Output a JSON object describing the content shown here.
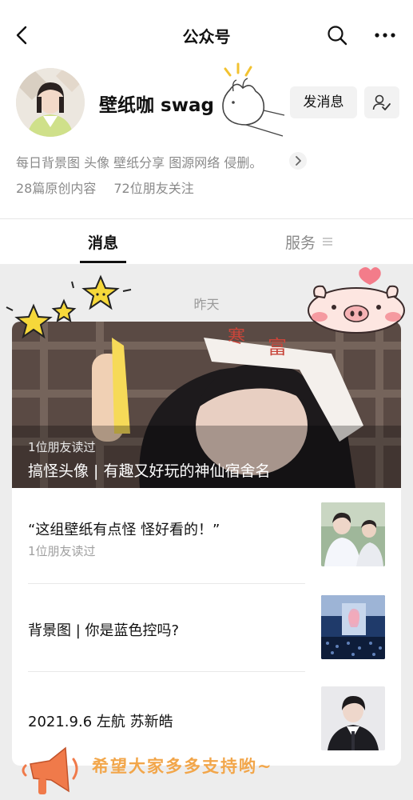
{
  "nav": {
    "title": "公众号"
  },
  "account": {
    "name": "壁纸咖 swag",
    "send_label": "发消息",
    "description": "每日背景图 头像 壁纸分享 图源网络 侵删。",
    "original_count": "28篇原创内容",
    "friends_follow": "72位朋友关注"
  },
  "tabs": {
    "messages": "消息",
    "services": "服务"
  },
  "feed": {
    "date": "昨天",
    "featured": {
      "read_by": "1位朋友读过",
      "title": "搞怪头像 | 有趣又好玩的神仙宿舍名"
    },
    "articles": [
      {
        "title": "“这组壁纸有点怪 怪好看的！”",
        "read_by": "1位朋友读过"
      },
      {
        "title": "背景图 | 你是蓝色控吗?",
        "read_by": ""
      },
      {
        "title": "2021.9.6 左航 苏新皓",
        "read_by": ""
      }
    ]
  },
  "footer": {
    "slogan": "希望大家多多支持哟~"
  },
  "colors": {
    "accent": "#f2a64a",
    "muted": "#8a8a8a",
    "background": "#ededed"
  }
}
